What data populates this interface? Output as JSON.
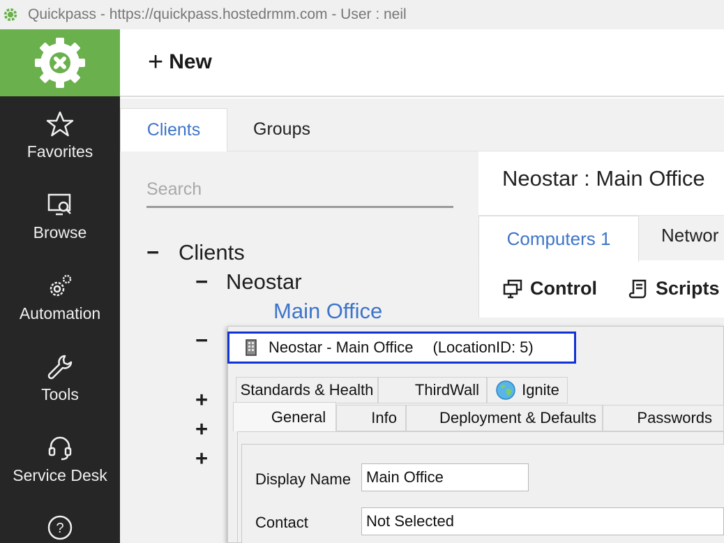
{
  "window": {
    "title": "Quickpass - https://quickpass.hostedrmm.com - User : neil"
  },
  "toolbar": {
    "new_label": "New"
  },
  "sidebar": {
    "items": [
      {
        "label": "Favorites",
        "icon": "star-icon"
      },
      {
        "label": "Browse",
        "icon": "browse-icon"
      },
      {
        "label": "Automation",
        "icon": "gears-icon"
      },
      {
        "label": "Tools",
        "icon": "wrench-icon"
      },
      {
        "label": "Service Desk",
        "icon": "headset-icon"
      },
      {
        "label": "",
        "icon": "help-icon"
      }
    ]
  },
  "left_tabs": [
    "Clients",
    "Groups"
  ],
  "search": {
    "placeholder": "Search",
    "value": ""
  },
  "tree": {
    "root": "Clients",
    "client": "Neostar",
    "location": "Main Office"
  },
  "right_panel": {
    "title": "Neostar : Main Office",
    "tabs": [
      "Computers 1",
      "Networ"
    ],
    "actions": [
      "Control",
      "Scripts"
    ]
  },
  "dialog": {
    "title": "Neostar - Main Office",
    "location_id": "(LocationID: 5)",
    "tabs_row1": [
      "Standards & Health",
      "ThirdWall",
      "Ignite"
    ],
    "tabs_row2": [
      "General",
      "Info",
      "Deployment & Defaults",
      "Passwords"
    ],
    "fields": {
      "display_name_label": "Display Name",
      "display_name_value": "Main Office",
      "contact_label": "Contact",
      "contact_value": "Not Selected"
    }
  },
  "colors": {
    "accent_green": "#6ab04c",
    "sidebar_bg": "#262626",
    "link_blue": "#3d74c9",
    "highlight_border": "#1033d6"
  }
}
